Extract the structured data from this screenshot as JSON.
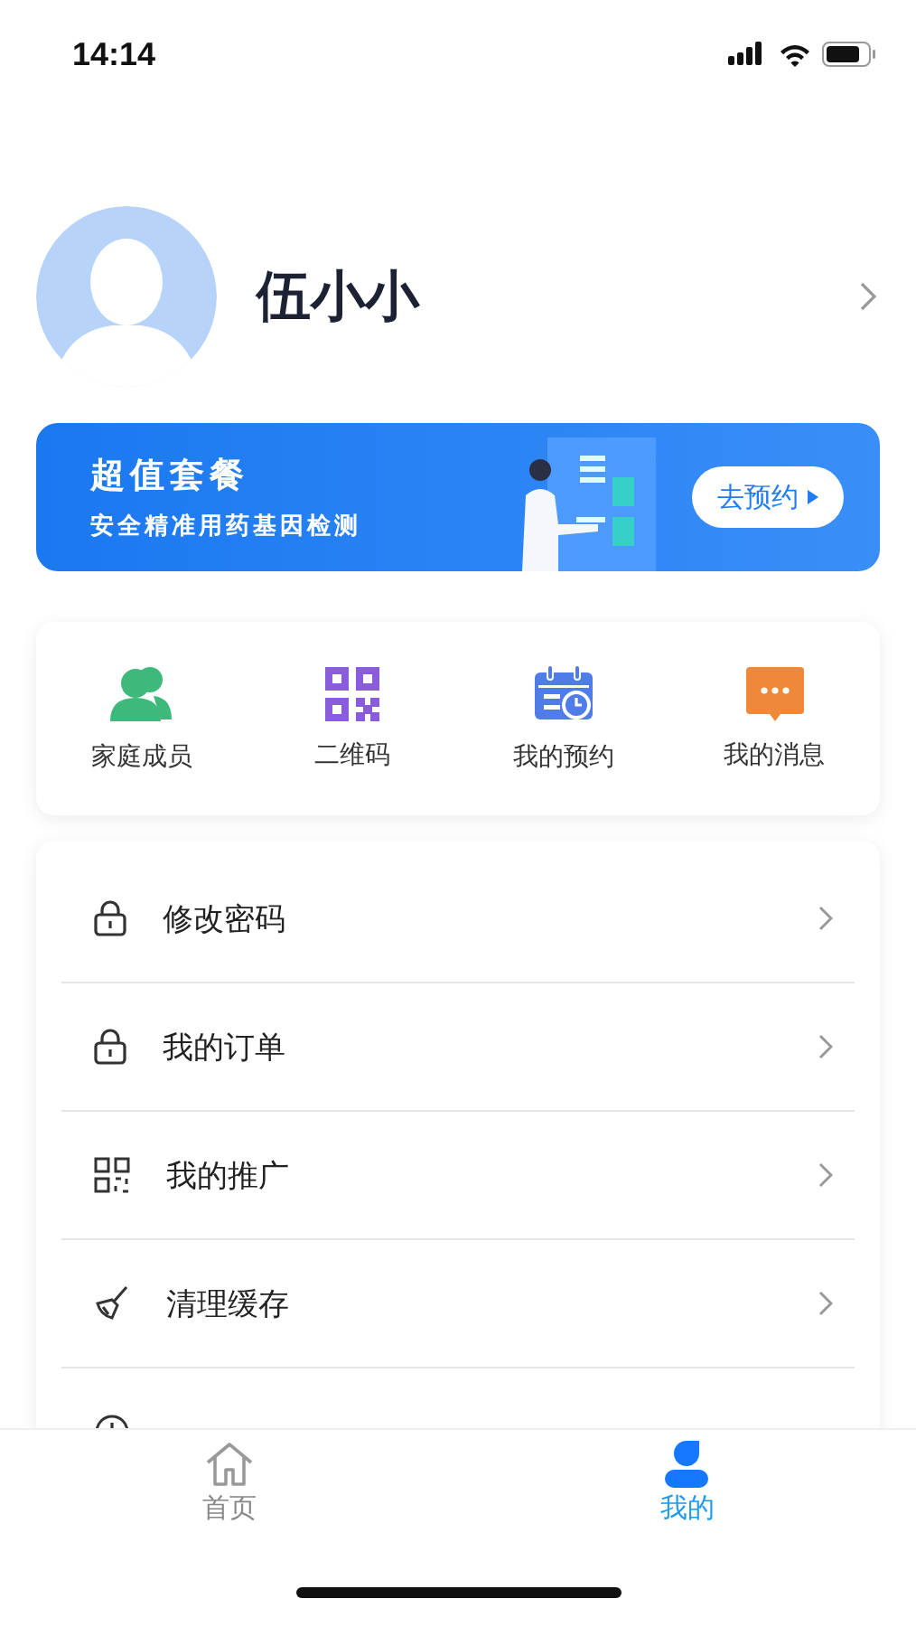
{
  "status_bar": {
    "time": "14:14"
  },
  "profile": {
    "name": "伍小小"
  },
  "banner": {
    "title": "超值套餐",
    "subtitle": "安全精准用药基因检测",
    "button": "去预约"
  },
  "shortcuts": [
    {
      "kind": "family",
      "label": "家庭成员"
    },
    {
      "kind": "qrcode",
      "label": "二维码"
    },
    {
      "kind": "calendar",
      "label": "我的预约"
    },
    {
      "kind": "message",
      "label": "我的消息"
    }
  ],
  "menu": [
    {
      "kind": "lock",
      "label": "修改密码"
    },
    {
      "kind": "lock",
      "label": "我的订单"
    },
    {
      "kind": "qrcode",
      "label": "我的推广"
    },
    {
      "kind": "broom",
      "label": "清理缓存"
    },
    {
      "kind": "info"
    }
  ],
  "tabs": [
    {
      "kind": "home",
      "label": "首页",
      "selected": false
    },
    {
      "kind": "person",
      "label": "我的",
      "selected": true
    }
  ]
}
